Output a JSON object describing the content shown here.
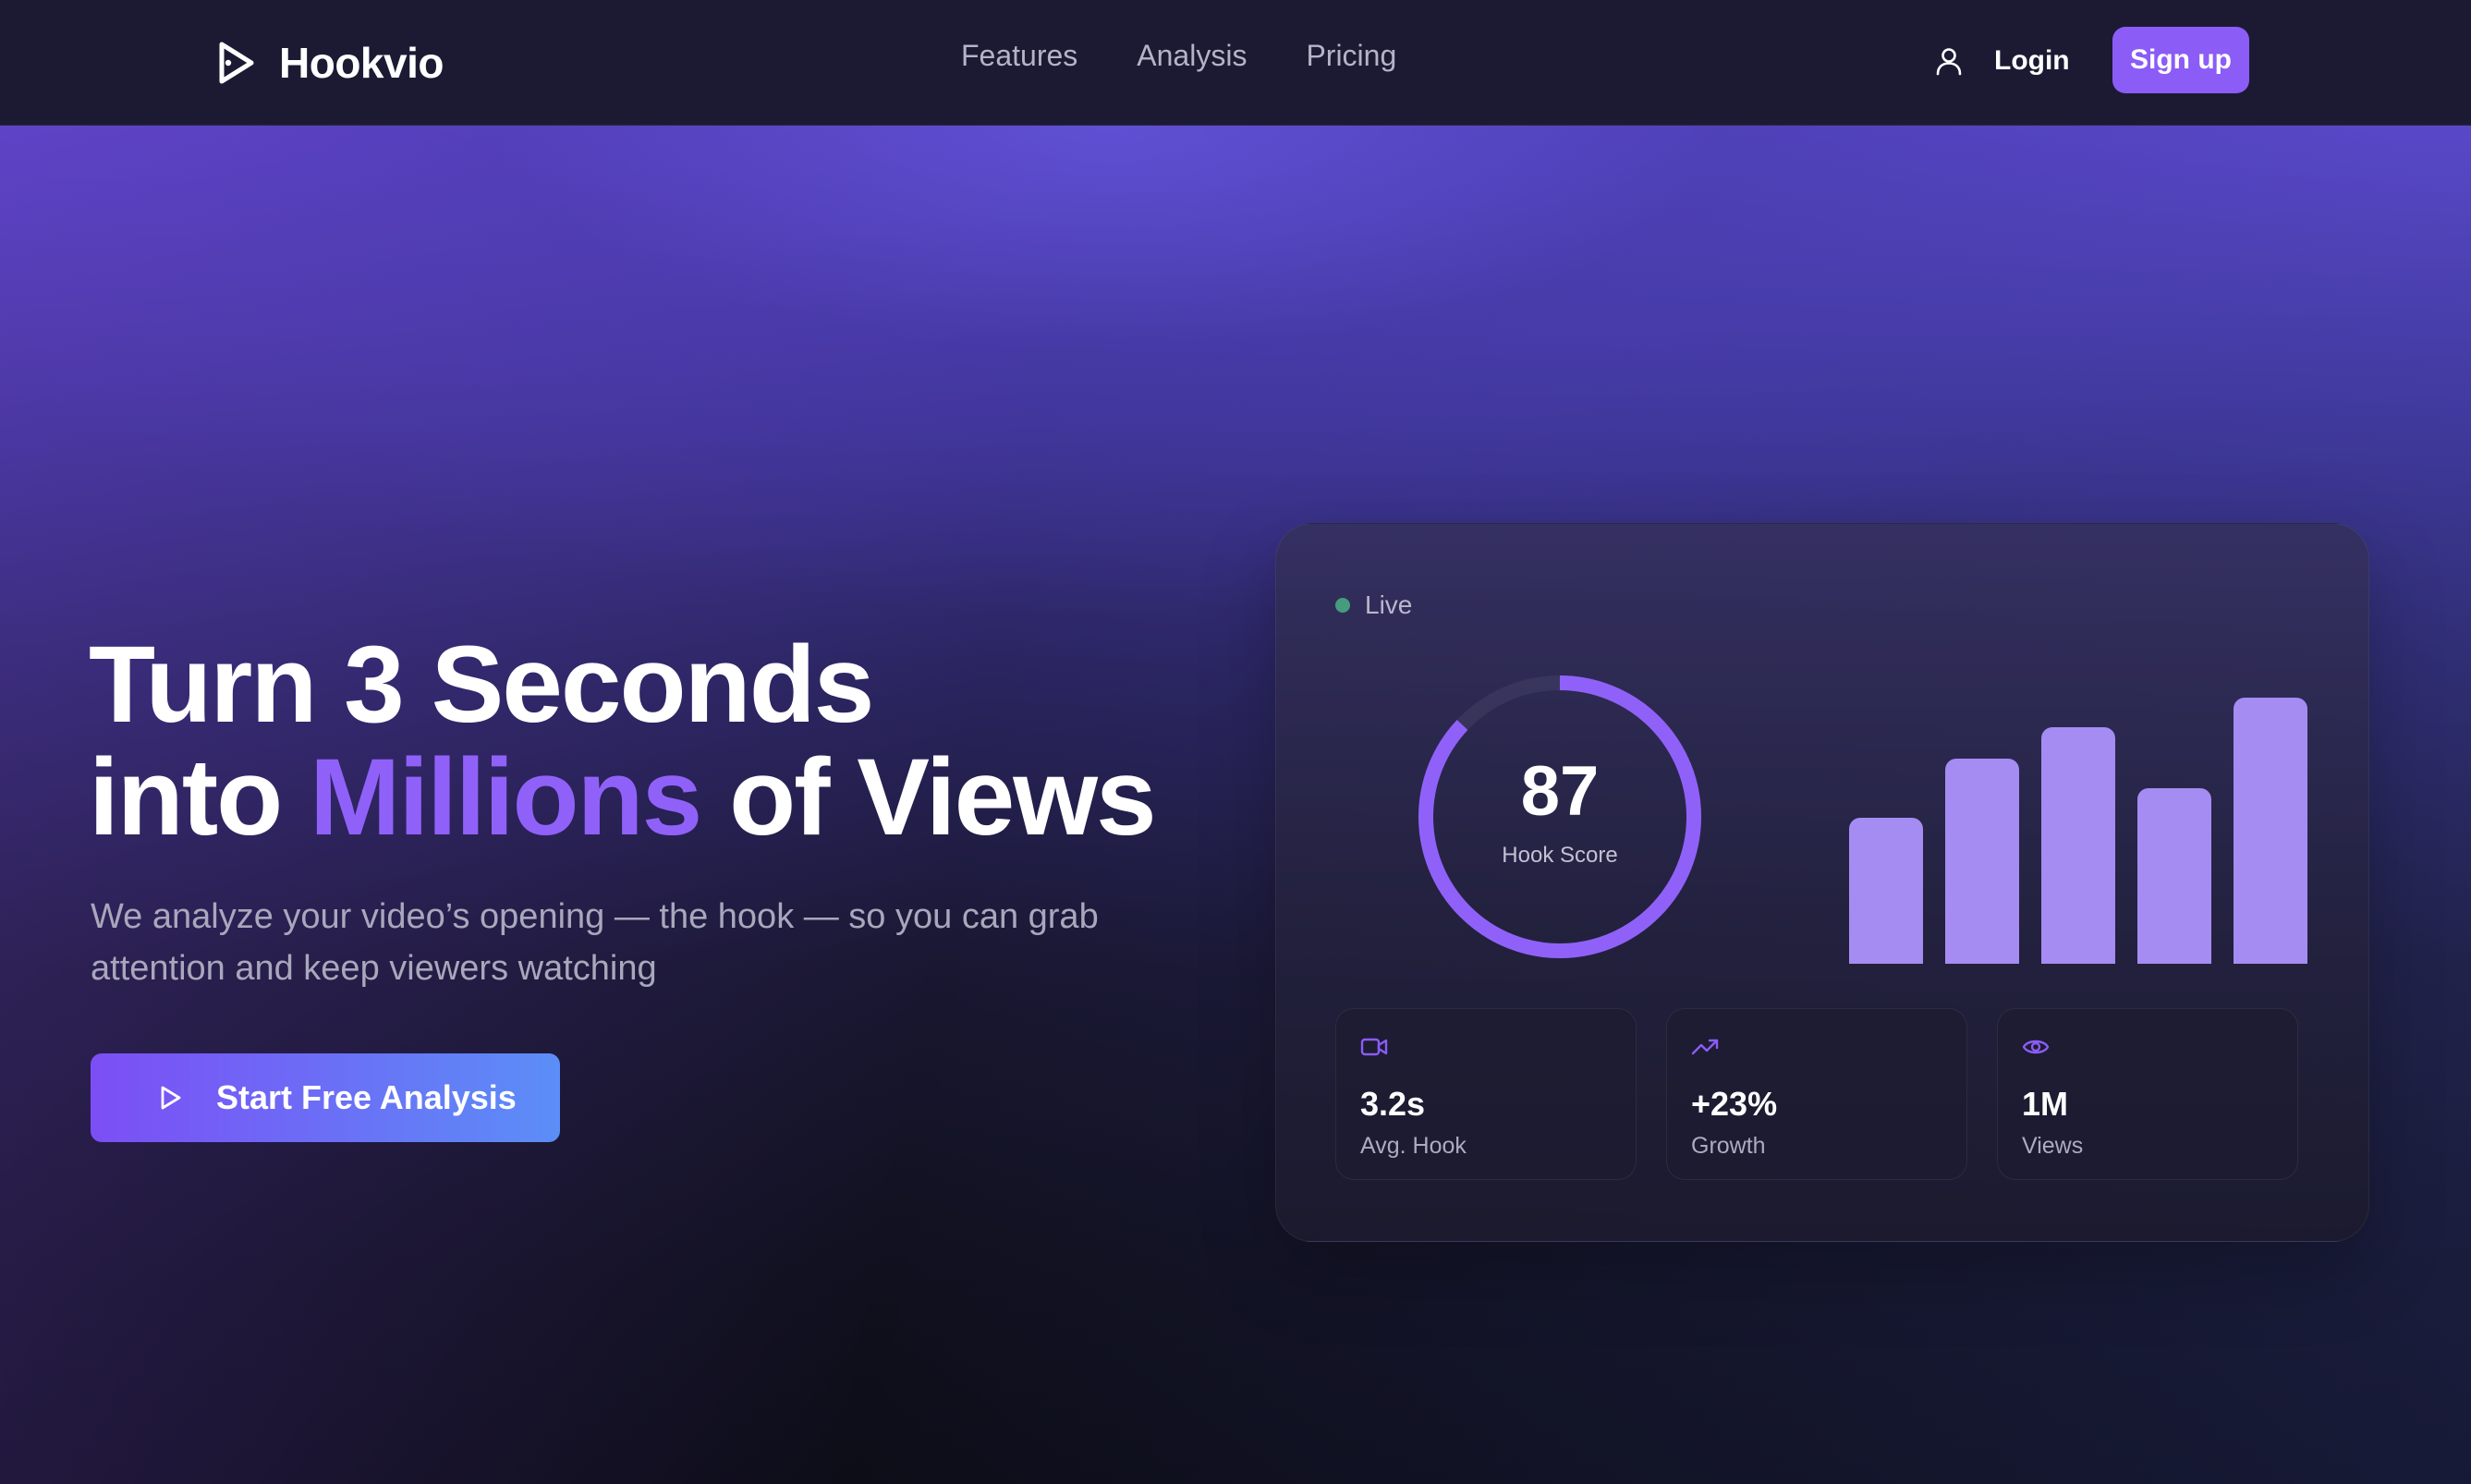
{
  "brand": {
    "name": "Hookvio"
  },
  "nav": {
    "items": [
      "Features",
      "Analysis",
      "Pricing"
    ]
  },
  "auth": {
    "login_label": "Login",
    "signup_label": "Sign up"
  },
  "hero": {
    "headline_line1": "Turn 3 Seconds",
    "headline_into": "into",
    "headline_accent": "Millions",
    "headline_end": "of Views",
    "subtext": "We analyze your video’s opening — the hook — so you can grab attention and keep viewers watching",
    "cta_label": "Start Free Analysis"
  },
  "dashboard": {
    "status_label": "Live",
    "score": {
      "value": "87",
      "label": "Hook Score",
      "fraction": 0.87
    },
    "bar_levels": [
      0.55,
      0.77,
      0.89,
      0.66,
      1.0
    ],
    "stats": [
      {
        "icon": "video-camera-icon",
        "value": "3.2s",
        "label": "Avg. Hook"
      },
      {
        "icon": "trending-up-icon",
        "value": "+23%",
        "label": "Growth"
      },
      {
        "icon": "eye-icon",
        "value": "1M",
        "label": "Views"
      }
    ]
  },
  "colors": {
    "accent": "#8b5cf6",
    "headline_accent": "#9061f9",
    "bar": "#a58cf2",
    "live_dot": "#4dc18a",
    "cta_gradient_start": "#7c4ef5",
    "cta_gradient_end": "#5b8ef7"
  }
}
